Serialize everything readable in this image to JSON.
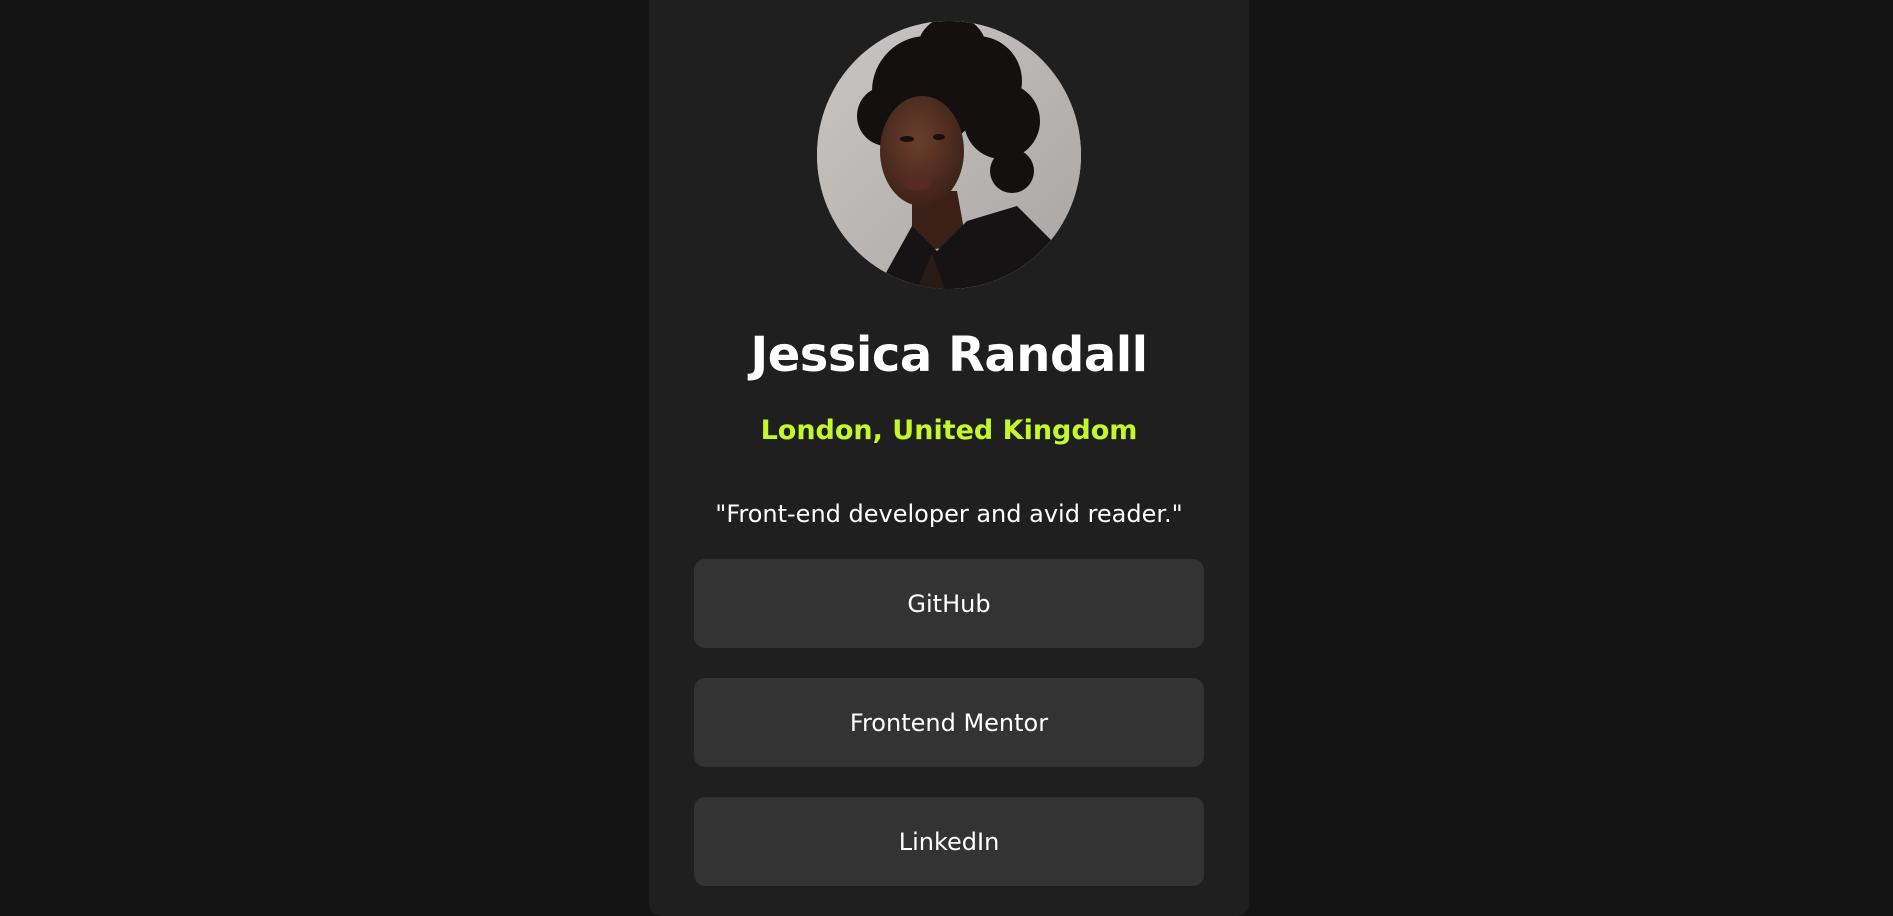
{
  "profile": {
    "name": "Jessica Randall",
    "location": "London, United Kingdom",
    "bio": "\"Front-end developer and avid reader.\""
  },
  "links": [
    {
      "label": "GitHub"
    },
    {
      "label": "Frontend Mentor"
    },
    {
      "label": "LinkedIn"
    }
  ],
  "colors": {
    "page_background": "#141414",
    "card_background": "#1f1f1f",
    "button_background": "#333333",
    "accent": "#c4f82a",
    "text": "#ffffff"
  }
}
